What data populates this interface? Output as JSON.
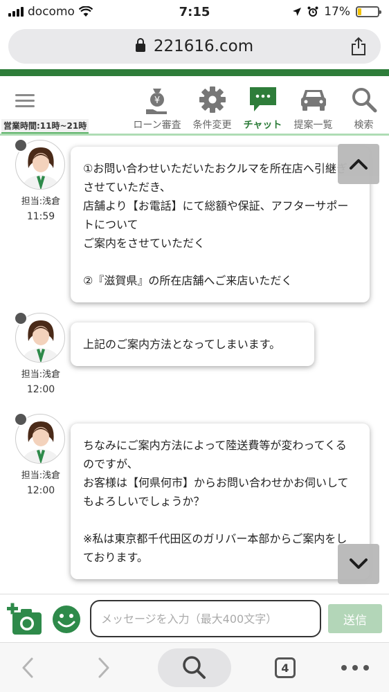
{
  "status_bar": {
    "carrier": "docomo",
    "time": "7:15",
    "battery": "17%",
    "battery_level": 0.17
  },
  "browser": {
    "url": "221616.com",
    "tab_count": "4"
  },
  "site_header": {
    "hours": "営業時間:11時~21時",
    "nav": [
      {
        "label": "ローン審査",
        "icon": "loan-icon"
      },
      {
        "label": "条件変更",
        "icon": "gear-icon"
      },
      {
        "label": "チャット",
        "icon": "chat-icon",
        "active": true
      },
      {
        "label": "提案一覧",
        "icon": "car-icon"
      },
      {
        "label": "検索",
        "icon": "search-icon"
      }
    ]
  },
  "messages": [
    {
      "agent": "担当:浅倉",
      "time": "11:59",
      "text": "①お問い合わせいただいたおクルマを所在店へ引継ぎさせていただき、\n店舗より【お電話】にて総額や保証、アフターサポートについて\nご案内をさせていただく\n\n②『滋賀県』の所在店舗へご来店いただく"
    },
    {
      "agent": "担当:浅倉",
      "time": "12:00",
      "text": "上記のご案内方法となってしまいます。"
    },
    {
      "agent": "担当:浅倉",
      "time": "12:00",
      "text": "ちなみにご案内方法によって陸送費等が変わってくるのですが、\nお客様は【何県何市】からお問い合わせかお伺いしてもよろしいでしょうか？\n\n※私は東京都千代田区のガリバー本部からご案内をしております。"
    }
  ],
  "composer": {
    "placeholder": "メッセージを入力（最大400文字）",
    "send_label": "送信"
  },
  "colors": {
    "brand_green": "#2e7d3a",
    "send_disabled": "#b3d6b8"
  }
}
